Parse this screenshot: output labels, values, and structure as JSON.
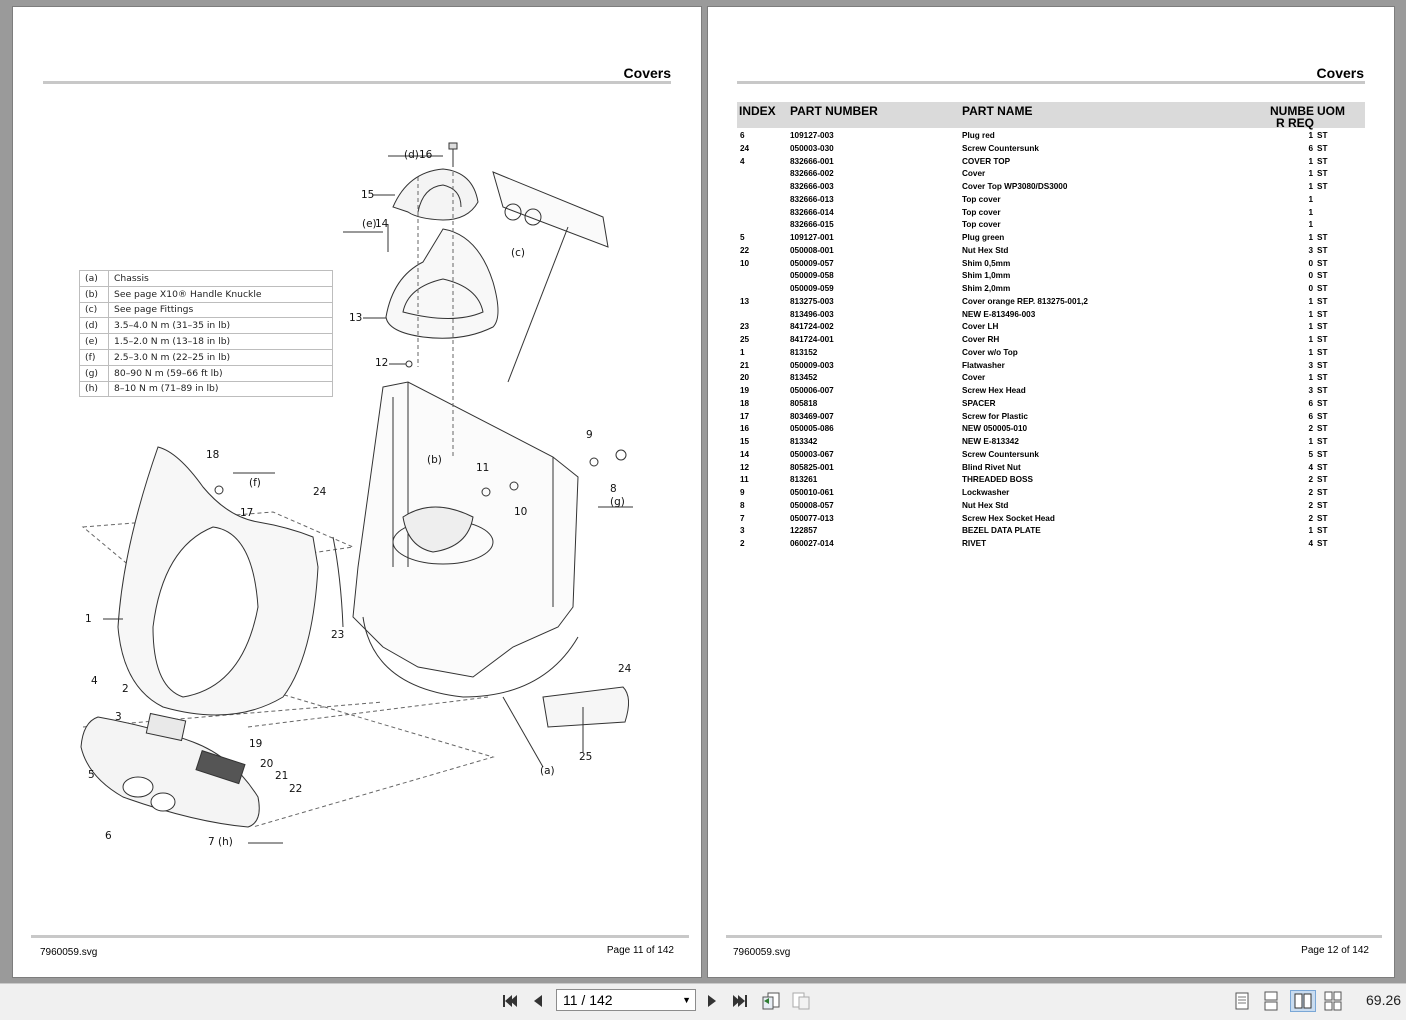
{
  "left_page": {
    "title": "Covers",
    "file": "7960059.svg",
    "page_label": "Page 11 of  142",
    "legend": [
      {
        "key": "(a)",
        "value": "Chassis"
      },
      {
        "key": "(b)",
        "value": "See page X10® Handle Knuckle"
      },
      {
        "key": "(c)",
        "value": "See page Fittings"
      },
      {
        "key": "(d)",
        "value": "3.5–4.0 N m (31–35 in lb)"
      },
      {
        "key": "(e)",
        "value": "1.5–2.0 N m (13–18 in lb)"
      },
      {
        "key": "(f)",
        "value": "2.5–3.0 N m (22–25 in lb)"
      },
      {
        "key": "(g)",
        "value": "80–90 N m (59–66 ft lb)"
      },
      {
        "key": "(h)",
        "value": "8–10 N m (71–89 in lb)"
      }
    ],
    "callouts": [
      "(d)",
      "16",
      "15",
      "(e)",
      "14",
      "(c)",
      "13",
      "12",
      "(b)",
      "11",
      "10",
      "9",
      "8",
      "(g)",
      "18",
      "(f)",
      "17",
      "24",
      "1",
      "23",
      "4",
      "2",
      "3",
      "19",
      "20",
      "21",
      "22",
      "5",
      "6",
      "7",
      "(h)",
      "(a)",
      "24",
      "25"
    ]
  },
  "right_page": {
    "title": "Covers",
    "file": "7960059.svg",
    "page_label": "Page 12 of  142",
    "headers": {
      "index": "INDEX",
      "part_number": "PART NUMBER",
      "part_name": "PART NAME",
      "number_req_1": "NUMBE",
      "number_req_2": "R REQ",
      "uom": "UOM"
    },
    "rows": [
      [
        "6",
        "109127-003",
        "Plug red",
        "1",
        "ST"
      ],
      [
        "24",
        "050003-030",
        "Screw Countersunk",
        "6",
        "ST"
      ],
      [
        "4",
        "832666-001",
        "COVER TOP",
        "1",
        "ST"
      ],
      [
        "",
        "832666-002",
        "Cover",
        "1",
        "ST"
      ],
      [
        "",
        "832666-003",
        "Cover Top WP3080/DS3000",
        "1",
        "ST"
      ],
      [
        "",
        "832666-013",
        "Top cover",
        "1",
        ""
      ],
      [
        "",
        "832666-014",
        "Top cover",
        "1",
        ""
      ],
      [
        "",
        "832666-015",
        "Top cover",
        "1",
        ""
      ],
      [
        "5",
        "109127-001",
        "Plug green",
        "1",
        "ST"
      ],
      [
        "22",
        "050008-001",
        "Nut Hex Std",
        "3",
        "ST"
      ],
      [
        "10",
        "050009-057",
        "Shim 0,5mm",
        "0",
        "ST"
      ],
      [
        "",
        "050009-058",
        "Shim 1,0mm",
        "0",
        "ST"
      ],
      [
        "",
        "050009-059",
        "Shim 2,0mm",
        "0",
        "ST"
      ],
      [
        "13",
        "813275-003",
        "Cover orange REP. 813275-001,2",
        "1",
        "ST"
      ],
      [
        "",
        "813496-003",
        "NEW E-813496-003",
        "1",
        "ST"
      ],
      [
        "23",
        "841724-002",
        "Cover LH",
        "1",
        "ST"
      ],
      [
        "25",
        "841724-001",
        "Cover RH",
        "1",
        "ST"
      ],
      [
        "1",
        "813152",
        "Cover w/o Top",
        "1",
        "ST"
      ],
      [
        "21",
        "050009-003",
        "Flatwasher",
        "3",
        "ST"
      ],
      [
        "20",
        "813452",
        "Cover",
        "1",
        "ST"
      ],
      [
        "19",
        "050006-007",
        "Screw Hex Head",
        "3",
        "ST"
      ],
      [
        "18",
        "805818",
        "SPACER",
        "6",
        "ST"
      ],
      [
        "17",
        "803469-007",
        "Screw for Plastic",
        "6",
        "ST"
      ],
      [
        "16",
        "050005-086",
        "NEW 050005-010",
        "2",
        "ST"
      ],
      [
        "15",
        "813342",
        "NEW E-813342",
        "1",
        "ST"
      ],
      [
        "14",
        "050003-067",
        "Screw Countersunk",
        "5",
        "ST"
      ],
      [
        "12",
        "805825-001",
        "Blind Rivet Nut",
        "4",
        "ST"
      ],
      [
        "11",
        "813261",
        "THREADED BOSS",
        "2",
        "ST"
      ],
      [
        "9",
        "050010-061",
        "Lockwasher",
        "2",
        "ST"
      ],
      [
        "8",
        "050008-057",
        "Nut Hex Std",
        "2",
        "ST"
      ],
      [
        "7",
        "050077-013",
        "Screw Hex Socket Head",
        "2",
        "ST"
      ],
      [
        "3",
        "122857",
        "BEZEL DATA PLATE",
        "1",
        "ST"
      ],
      [
        "2",
        "060027-014",
        "RIVET",
        "4",
        "ST"
      ]
    ]
  },
  "toolbar": {
    "page_input": "11 / 142",
    "zoom": "69.26",
    "icons": [
      "first-page-icon",
      "previous-page-icon",
      "next-page-icon",
      "last-page-icon",
      "previous-view-icon",
      "next-view-icon",
      "single-page-view-icon",
      "single-page-continuous-icon",
      "two-page-view-icon",
      "two-page-continuous-icon"
    ]
  }
}
